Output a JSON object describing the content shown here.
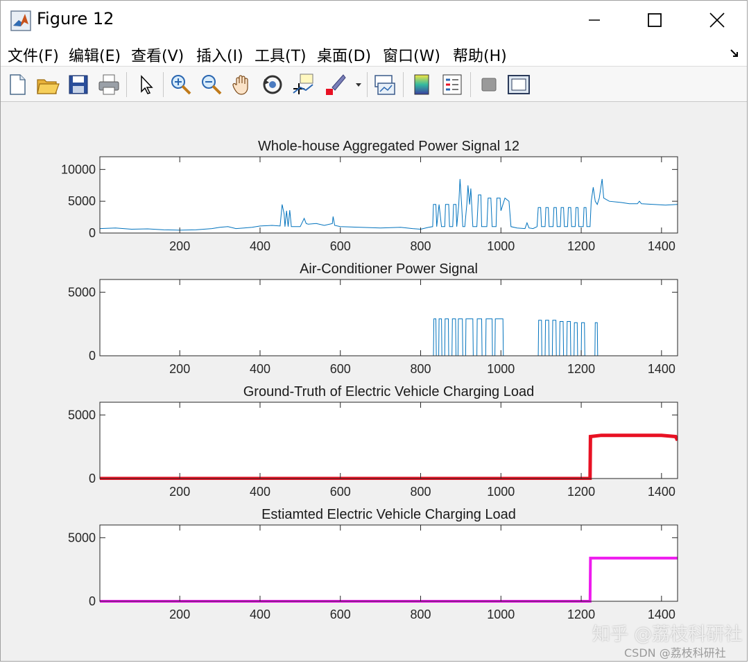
{
  "window": {
    "title": "Figure 12"
  },
  "menu": {
    "items": [
      "文件(F)",
      "编辑(E)",
      "查看(V)",
      "插入(I)",
      "工具(T)",
      "桌面(D)",
      "窗口(W)",
      "帮助(H)"
    ]
  },
  "toolbar": {
    "icons": [
      "new-figure-icon",
      "open-file-icon",
      "save-icon",
      "print-icon",
      "pointer-icon",
      "zoom-in-icon",
      "zoom-out-icon",
      "pan-icon",
      "rotate-3d-icon",
      "data-cursor-icon",
      "brush-icon",
      "link-plot-icon",
      "colorbar-icon",
      "legend-icon",
      "hide-plot-tools-icon",
      "show-plot-tools-icon"
    ]
  },
  "watermark": {
    "zhihu": "知乎 @荔枝科研社",
    "csdn": "CSDN @荔枝科研社"
  },
  "chart_data": [
    {
      "type": "line",
      "title": "Whole-house Aggregated Power Signal 12",
      "xlim": [
        1,
        1440
      ],
      "ylim": [
        0,
        12000
      ],
      "xticks": [
        200,
        400,
        600,
        800,
        1000,
        1200,
        1400
      ],
      "yticks": [
        0,
        5000,
        10000
      ],
      "color": "#0072bd",
      "series": [
        {
          "points": [
            [
              1,
              700
            ],
            [
              40,
              800
            ],
            [
              80,
              600
            ],
            [
              120,
              650
            ],
            [
              160,
              500
            ],
            [
              200,
              450
            ],
            [
              240,
              500
            ],
            [
              280,
              700
            ],
            [
              300,
              900
            ],
            [
              320,
              1000
            ],
            [
              340,
              700
            ],
            [
              360,
              800
            ],
            [
              380,
              900
            ],
            [
              400,
              1100
            ],
            [
              430,
              1200
            ],
            [
              450,
              1100
            ],
            [
              455,
              4500
            ],
            [
              460,
              3000
            ],
            [
              462,
              1000
            ],
            [
              466,
              3500
            ],
            [
              470,
              1000
            ],
            [
              474,
              3600
            ],
            [
              478,
              1000
            ],
            [
              500,
              1000
            ],
            [
              510,
              2300
            ],
            [
              515,
              1500
            ],
            [
              520,
              1400
            ],
            [
              540,
              1500
            ],
            [
              560,
              1200
            ],
            [
              580,
              1500
            ],
            [
              582,
              2600
            ],
            [
              586,
              1200
            ],
            [
              600,
              1000
            ],
            [
              650,
              900
            ],
            [
              700,
              800
            ],
            [
              750,
              900
            ],
            [
              780,
              700
            ],
            [
              800,
              600
            ],
            [
              820,
              900
            ],
            [
              830,
              1000
            ],
            [
              832,
              4500
            ],
            [
              838,
              4500
            ],
            [
              840,
              1000
            ],
            [
              846,
              4500
            ],
            [
              852,
              1000
            ],
            [
              860,
              1000
            ],
            [
              862,
              4500
            ],
            [
              870,
              4500
            ],
            [
              872,
              1000
            ],
            [
              880,
              1000
            ],
            [
              882,
              4500
            ],
            [
              888,
              4500
            ],
            [
              890,
              1000
            ],
            [
              895,
              4500
            ],
            [
              898,
              8500
            ],
            [
              902,
              4500
            ],
            [
              905,
              1000
            ],
            [
              910,
              1000
            ],
            [
              915,
              4500
            ],
            [
              918,
              7500
            ],
            [
              922,
              4500
            ],
            [
              925,
              7000
            ],
            [
              930,
              1000
            ],
            [
              940,
              1000
            ],
            [
              944,
              6000
            ],
            [
              950,
              6000
            ],
            [
              952,
              1000
            ],
            [
              965,
              1000
            ],
            [
              968,
              5500
            ],
            [
              975,
              5500
            ],
            [
              978,
              1000
            ],
            [
              988,
              1000
            ],
            [
              990,
              5500
            ],
            [
              998,
              5500
            ],
            [
              1000,
              3500
            ],
            [
              1010,
              5500
            ],
            [
              1020,
              5000
            ],
            [
              1025,
              1000
            ],
            [
              1040,
              800
            ],
            [
              1060,
              700
            ],
            [
              1065,
              1600
            ],
            [
              1070,
              800
            ],
            [
              1080,
              700
            ],
            [
              1090,
              1000
            ],
            [
              1093,
              4000
            ],
            [
              1099,
              4000
            ],
            [
              1101,
              1000
            ],
            [
              1110,
              1000
            ],
            [
              1112,
              4000
            ],
            [
              1118,
              4000
            ],
            [
              1120,
              1000
            ],
            [
              1130,
              1000
            ],
            [
              1132,
              4000
            ],
            [
              1138,
              4000
            ],
            [
              1140,
              1000
            ],
            [
              1148,
              1000
            ],
            [
              1150,
              4000
            ],
            [
              1156,
              4000
            ],
            [
              1158,
              1000
            ],
            [
              1166,
              1000
            ],
            [
              1168,
              4000
            ],
            [
              1174,
              4000
            ],
            [
              1176,
              1000
            ],
            [
              1185,
              1000
            ],
            [
              1187,
              4000
            ],
            [
              1192,
              4000
            ],
            [
              1194,
              1000
            ],
            [
              1205,
              1000
            ],
            [
              1207,
              4000
            ],
            [
              1212,
              4000
            ],
            [
              1214,
              1000
            ],
            [
              1222,
              1000
            ],
            [
              1225,
              5000
            ],
            [
              1230,
              7200
            ],
            [
              1235,
              5000
            ],
            [
              1240,
              4500
            ],
            [
              1245,
              5500
            ],
            [
              1252,
              8500
            ],
            [
              1256,
              5500
            ],
            [
              1270,
              5000
            ],
            [
              1300,
              4800
            ],
            [
              1320,
              4600
            ],
            [
              1340,
              4600
            ],
            [
              1345,
              5000
            ],
            [
              1350,
              4600
            ],
            [
              1380,
              4500
            ],
            [
              1410,
              4400
            ],
            [
              1440,
              4500
            ]
          ]
        }
      ]
    },
    {
      "type": "line",
      "title": "Air-Conditioner Power Signal",
      "xlim": [
        1,
        1440
      ],
      "ylim": [
        0,
        6000
      ],
      "xticks": [
        200,
        400,
        600,
        800,
        1000,
        1200,
        1400
      ],
      "yticks": [
        0,
        5000
      ],
      "color": "#0072bd",
      "series": [
        {
          "points": [
            [
              1,
              0
            ],
            [
              832,
              0
            ],
            [
              833,
              2900
            ],
            [
              838,
              2900
            ],
            [
              839,
              0
            ],
            [
              845,
              0
            ],
            [
              846,
              2900
            ],
            [
              852,
              2900
            ],
            [
              853,
              0
            ],
            [
              860,
              0
            ],
            [
              861,
              2900
            ],
            [
              869,
              2900
            ],
            [
              870,
              0
            ],
            [
              878,
              0
            ],
            [
              879,
              2900
            ],
            [
              887,
              2900
            ],
            [
              888,
              0
            ],
            [
              893,
              0
            ],
            [
              894,
              2900
            ],
            [
              904,
              2900
            ],
            [
              905,
              0
            ],
            [
              912,
              0
            ],
            [
              913,
              2900
            ],
            [
              930,
              2900
            ],
            [
              931,
              0
            ],
            [
              940,
              0
            ],
            [
              941,
              2900
            ],
            [
              952,
              2900
            ],
            [
              953,
              0
            ],
            [
              962,
              0
            ],
            [
              963,
              2900
            ],
            [
              978,
              2900
            ],
            [
              979,
              0
            ],
            [
              985,
              0
            ],
            [
              986,
              2900
            ],
            [
              1005,
              2900
            ],
            [
              1006,
              0
            ],
            [
              1093,
              0
            ],
            [
              1094,
              2800
            ],
            [
              1101,
              2800
            ],
            [
              1102,
              0
            ],
            [
              1110,
              0
            ],
            [
              1111,
              2800
            ],
            [
              1119,
              2800
            ],
            [
              1120,
              0
            ],
            [
              1128,
              0
            ],
            [
              1129,
              2800
            ],
            [
              1137,
              2800
            ],
            [
              1138,
              0
            ],
            [
              1146,
              0
            ],
            [
              1147,
              2700
            ],
            [
              1155,
              2700
            ],
            [
              1156,
              0
            ],
            [
              1164,
              0
            ],
            [
              1165,
              2700
            ],
            [
              1173,
              2700
            ],
            [
              1174,
              0
            ],
            [
              1182,
              0
            ],
            [
              1183,
              2600
            ],
            [
              1190,
              2600
            ],
            [
              1191,
              0
            ],
            [
              1200,
              0
            ],
            [
              1201,
              2600
            ],
            [
              1208,
              2600
            ],
            [
              1209,
              0
            ],
            [
              1234,
              0
            ],
            [
              1235,
              2600
            ],
            [
              1240,
              2600
            ],
            [
              1241,
              0
            ],
            [
              1440,
              0
            ]
          ]
        }
      ]
    },
    {
      "type": "line",
      "title": "Ground-Truth of Electric Vehicle Charging Load",
      "xlim": [
        1,
        1440
      ],
      "ylim": [
        0,
        6000
      ],
      "xticks": [
        200,
        400,
        600,
        800,
        1000,
        1200,
        1400
      ],
      "yticks": [
        0,
        5000
      ],
      "color": "#e81123",
      "series": [
        {
          "points": [
            [
              1,
              0
            ],
            [
              1222,
              0
            ],
            [
              1223,
              3300
            ],
            [
              1250,
              3400
            ],
            [
              1300,
              3400
            ],
            [
              1350,
              3400
            ],
            [
              1400,
              3400
            ],
            [
              1435,
              3300
            ],
            [
              1440,
              3000
            ]
          ]
        }
      ]
    },
    {
      "type": "line",
      "title": "Estiamted Electric Vehicle Charging Load",
      "xlim": [
        1,
        1440
      ],
      "ylim": [
        0,
        6000
      ],
      "xticks": [
        200,
        400,
        600,
        800,
        1000,
        1200,
        1400
      ],
      "yticks": [
        0,
        5000
      ],
      "color": "#ee1aee",
      "series": [
        {
          "points": [
            [
              1,
              0
            ],
            [
              1222,
              0
            ],
            [
              1223,
              3400
            ],
            [
              1440,
              3400
            ]
          ]
        }
      ]
    }
  ]
}
